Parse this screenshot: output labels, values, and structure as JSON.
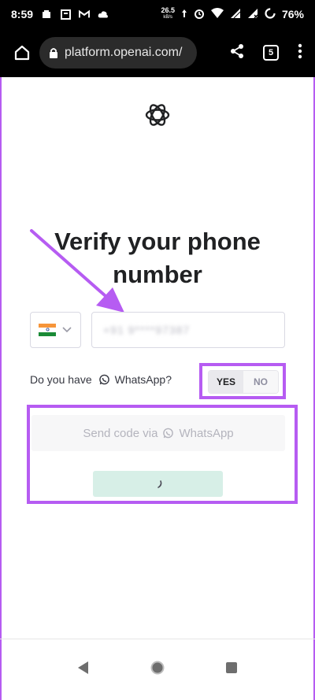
{
  "status_bar": {
    "time": "8:59",
    "speed_value": "26.5",
    "speed_unit": "kB/s",
    "battery": "76%"
  },
  "browser": {
    "url": "platform.openai.com/",
    "tab_count": "5"
  },
  "page": {
    "title": "Verify your phone number",
    "phone_value": "+91 9****97387",
    "whatsapp_question_prefix": "Do you have",
    "whatsapp_label": "WhatsApp?",
    "toggle_yes": "YES",
    "toggle_no": "NO",
    "send_prefix": "Send code via",
    "send_app": "WhatsApp"
  },
  "colors": {
    "annotation": "#b65cf2",
    "loading_button": "#d7efe7"
  },
  "icons": {
    "home": "home-icon",
    "lock": "lock-icon",
    "share": "share-icon",
    "tabs": "tabs-icon",
    "menu": "more-vert-icon",
    "logo": "openai-logo",
    "flag": "india-flag-icon",
    "chevron": "chevron-down-icon",
    "whatsapp": "whatsapp-icon",
    "spinner": "spinner-icon"
  }
}
